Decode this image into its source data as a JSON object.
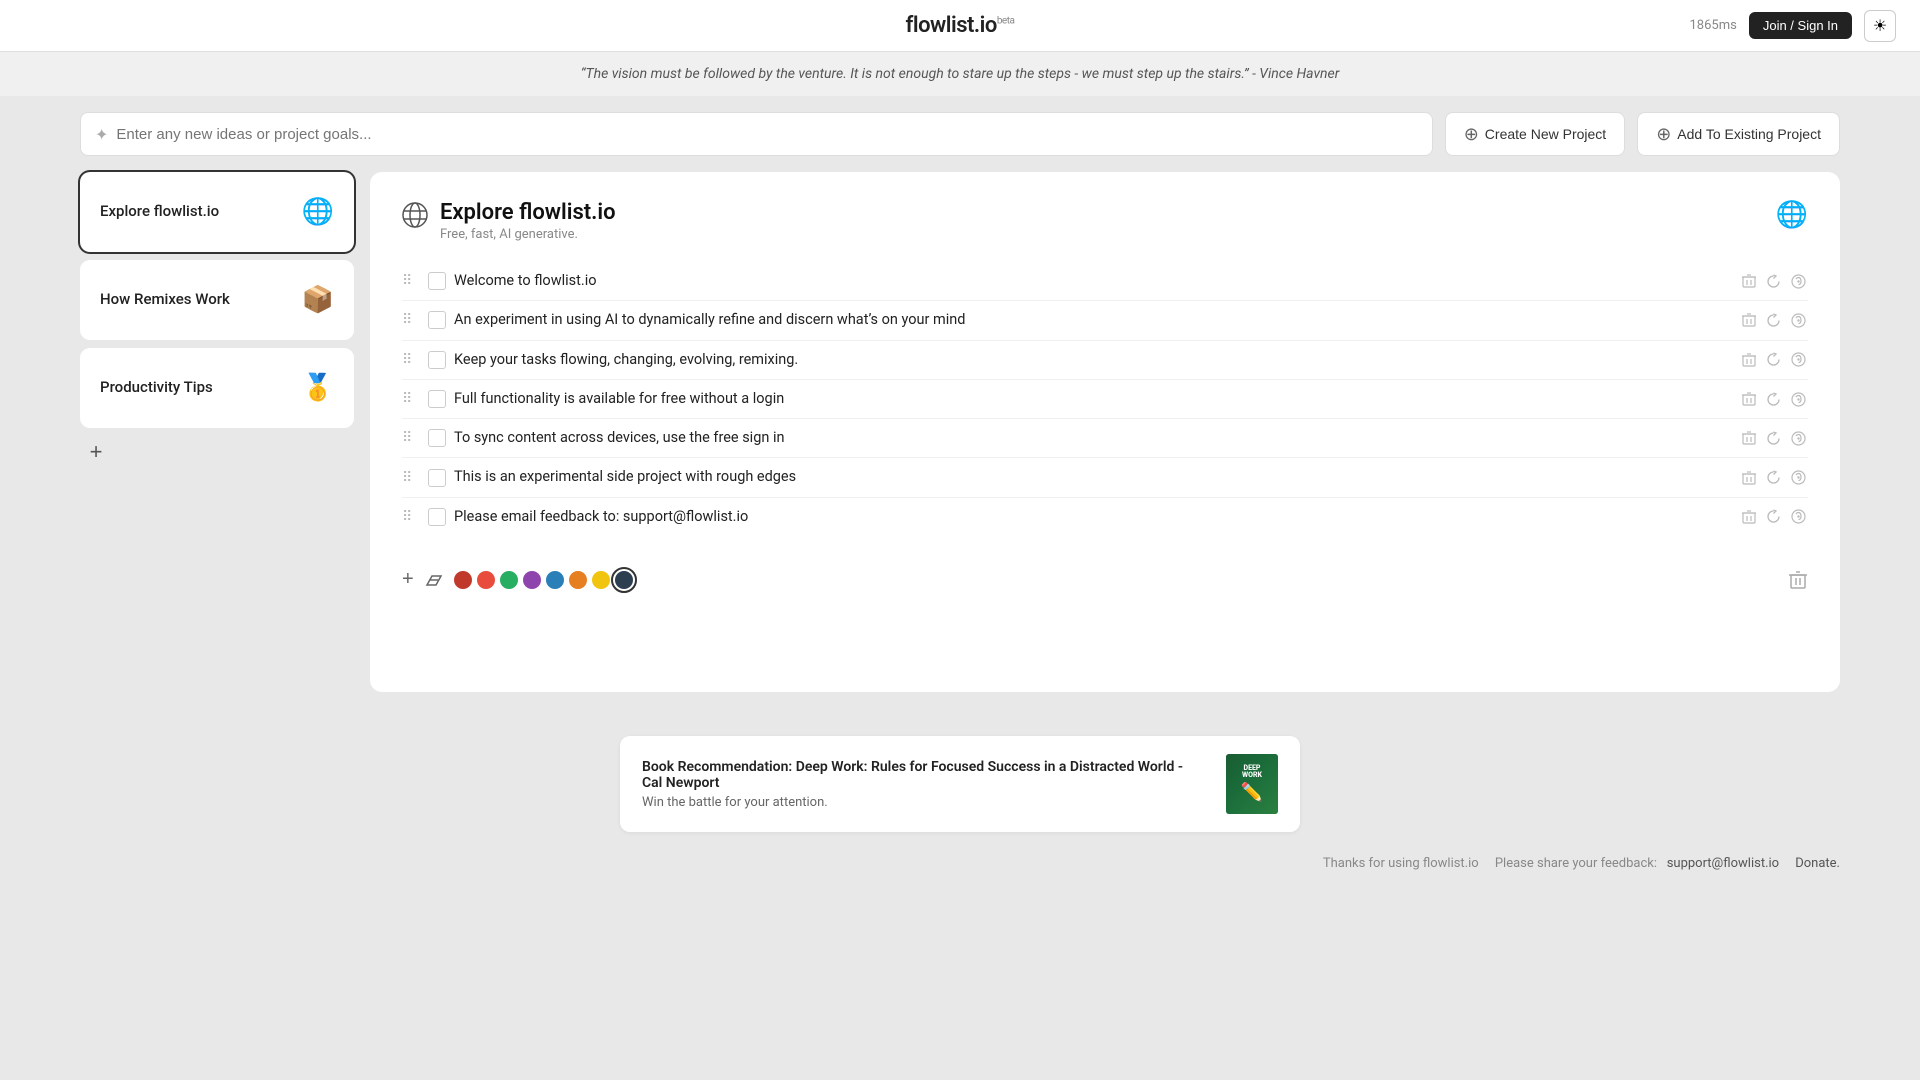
{
  "app": {
    "name": "flowlist.io",
    "badge": "beta",
    "response_ms": "1865ms",
    "signin_label": "Join / Sign In",
    "theme_icon": "☀"
  },
  "quote": {
    "text": "“The vision must be followed by the venture. It is not enough to stare up the steps - we must step up the stairs.” - Vince Havner"
  },
  "search": {
    "placeholder": "Enter any new ideas or project goals...",
    "create_label": "Create New Project",
    "add_label": "Add To Existing Project"
  },
  "sidebar": {
    "items": [
      {
        "id": "explore",
        "label": "Explore flowlist.io",
        "icon": "🌐",
        "active": true
      },
      {
        "id": "remixes",
        "label": "How Remixes Work",
        "icon": "📦",
        "active": false
      },
      {
        "id": "productivity",
        "label": "Productivity Tips",
        "icon": "🥇",
        "active": false
      }
    ],
    "add_label": "+"
  },
  "main": {
    "title": "Explore flowlist.io",
    "subtitle": "Free, fast, AI generative.",
    "icon": "🌐",
    "tasks": [
      {
        "id": 1,
        "text": "Welcome to flowlist.io",
        "checked": false
      },
      {
        "id": 2,
        "text": "An experiment in using AI to dynamically refine and discern what’s on your mind",
        "checked": false
      },
      {
        "id": 3,
        "text": "Keep your tasks flowing, changing, evolving, remixing.",
        "checked": false
      },
      {
        "id": 4,
        "text": "Full functionality is available for free without a login",
        "checked": false
      },
      {
        "id": 5,
        "text": "To sync content across devices, use the free sign in",
        "checked": false
      },
      {
        "id": 6,
        "text": "This is an experimental side project with rough edges",
        "checked": false
      },
      {
        "id": 7,
        "text": "Please email feedback to: support@flowlist.io",
        "checked": false
      }
    ],
    "colors": [
      {
        "hex": "#c0392b",
        "active": false
      },
      {
        "hex": "#e74c3c",
        "active": false
      },
      {
        "hex": "#27ae60",
        "active": false
      },
      {
        "hex": "#8e44ad",
        "active": false
      },
      {
        "hex": "#2980b9",
        "active": false
      },
      {
        "hex": "#e67e22",
        "active": false
      },
      {
        "hex": "#f1c40f",
        "active": false
      },
      {
        "hex": "#2c3e50",
        "active": true
      }
    ]
  },
  "book_rec": {
    "title": "Book Recommendation: Deep Work: Rules for Focused Success in a Distracted World - Cal Newport",
    "subtitle": "Win the battle for your attention."
  },
  "footer": {
    "thanks": "Thanks for using flowlist.io",
    "feedback_label": "Please share your feedback:",
    "feedback_email": "support@flowlist.io",
    "donate": "Donate."
  }
}
